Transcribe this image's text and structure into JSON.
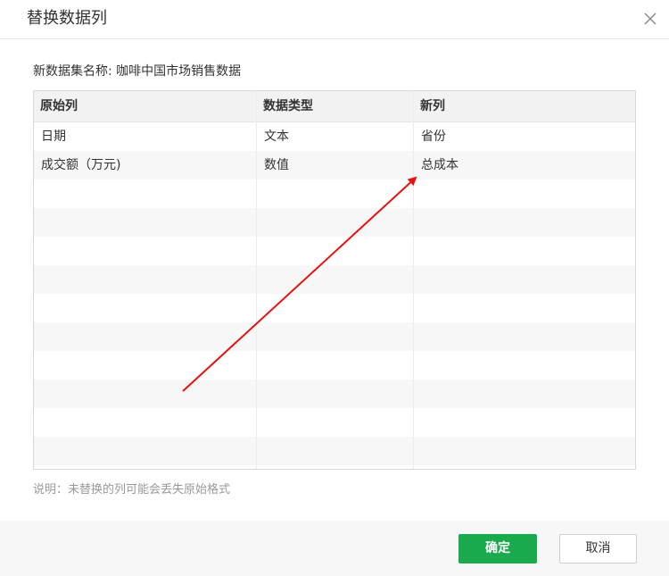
{
  "dialog": {
    "title": "替换数据列",
    "dataset_name_label": "新数据集名称: 咖啡中国市场销售数据",
    "hint": "说明：未替换的列可能会丢失原始格式",
    "ok_label": "确定",
    "cancel_label": "取消"
  },
  "table": {
    "columns": [
      "原始列",
      "数据类型",
      "新列"
    ],
    "rows": [
      {
        "original": "日期",
        "type": "文本",
        "new": "省份"
      },
      {
        "original": "成交额（万元)",
        "type": "数值",
        "new": "总成本"
      }
    ]
  },
  "colors": {
    "primary": "#1aa94d",
    "annotation_arrow": "#e81010"
  },
  "icons": {
    "close": "close-icon"
  }
}
